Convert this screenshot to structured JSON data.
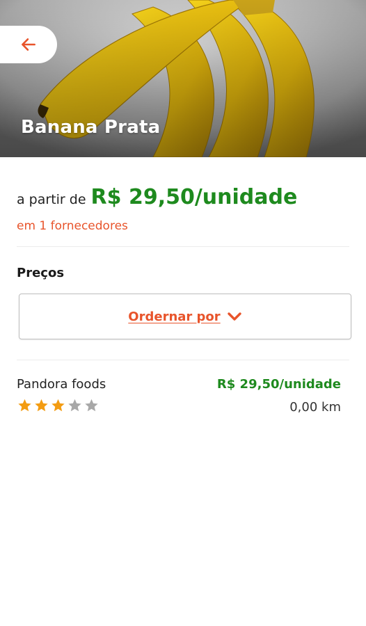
{
  "product": {
    "name": "Banana Prata",
    "image": "banana-bunch-image"
  },
  "back": {
    "icon": "arrow-left-icon"
  },
  "price": {
    "prefix": "a partir de",
    "value": "R$ 29,50/unidade",
    "suppliers_text": "em 1 fornecedores"
  },
  "prices_section": {
    "title": "Preços",
    "sort_label": "Ordernar por",
    "sort_icon": "chevron-down-icon"
  },
  "suppliers": [
    {
      "name": "Pandora foods",
      "price": "R$ 29,50/unidade",
      "distance": "0,00 km",
      "rating": 3,
      "rating_max": 5
    }
  ],
  "colors": {
    "accent": "#e8542b",
    "price_green": "#1e8a1e",
    "star_filled": "#f39c12",
    "star_empty": "#a8a8a8"
  }
}
